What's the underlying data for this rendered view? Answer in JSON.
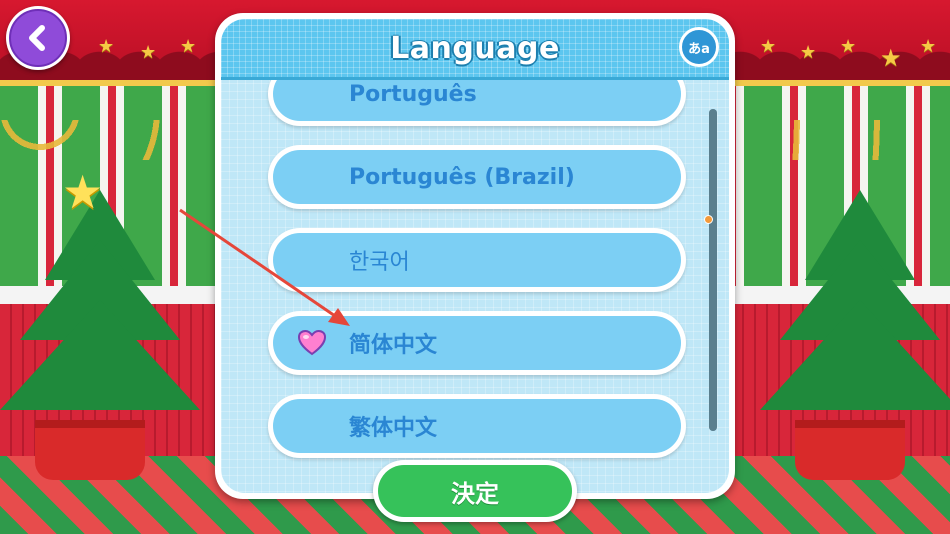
{
  "dialog": {
    "title": "Language",
    "lang_icon_label": "あa",
    "items": [
      {
        "label": "Português",
        "selected": false
      },
      {
        "label": "Português (Brazil)",
        "selected": false
      },
      {
        "label": "한국어",
        "selected": false
      },
      {
        "label": "简体中文",
        "selected": true
      },
      {
        "label": "繁体中文",
        "selected": false
      }
    ],
    "confirm_label": "決定"
  },
  "colors": {
    "header": "#5cc6ef",
    "pill": "#7ccff4",
    "label": "#2a86d3",
    "confirm": "#36c25a",
    "back": "#8f4bd9",
    "heart": "#ff7fd0",
    "arrow": "#e5473a"
  },
  "icons": {
    "back": "chevron-left-icon",
    "language": "language-icon",
    "selected": "heart-icon"
  }
}
